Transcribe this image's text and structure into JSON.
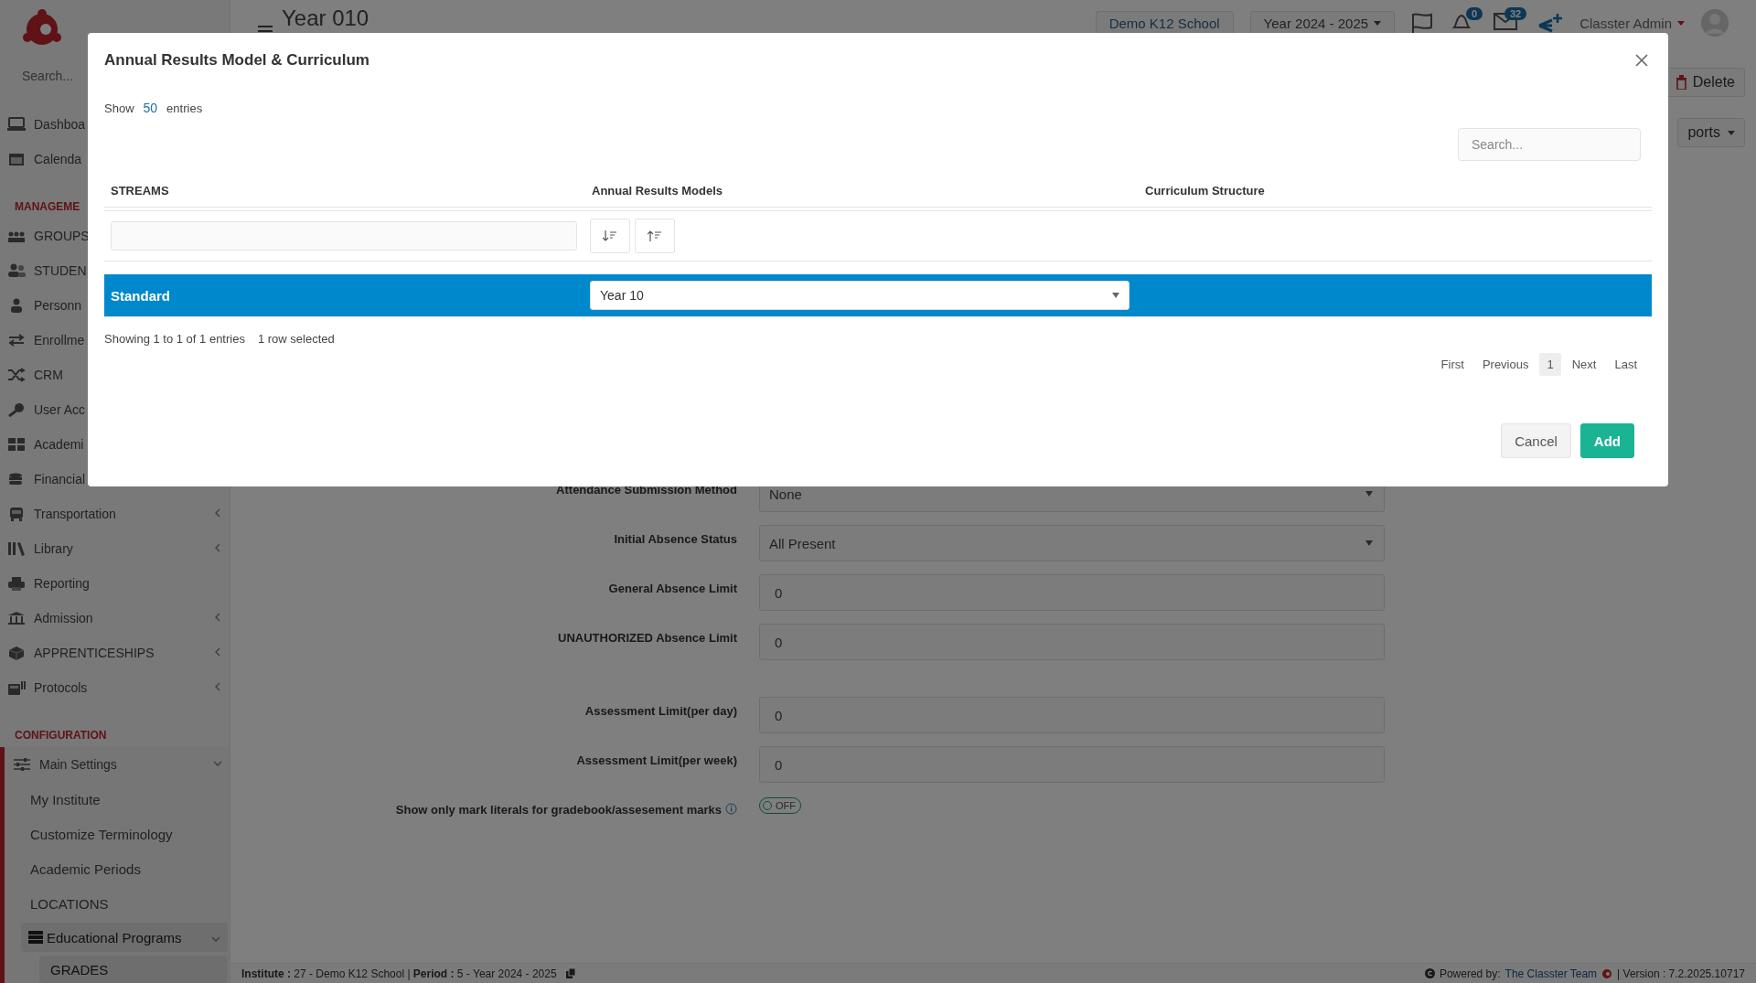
{
  "header": {
    "title": "Year 010",
    "school_button": "Demo K12 School",
    "year_dropdown": "Year 2024 - 2025",
    "notification_count": "0",
    "message_count": "32",
    "user_name": "Classter Admin"
  },
  "sidebar": {
    "search_placeholder": "Search...",
    "items": [
      {
        "kind": "item",
        "label": "Dashboa"
      },
      {
        "kind": "item",
        "label": "Calenda"
      },
      {
        "kind": "section",
        "label": "MANAGEME"
      },
      {
        "kind": "item",
        "label": "GROUPS"
      },
      {
        "kind": "item",
        "label": "STUDEN"
      },
      {
        "kind": "item",
        "label": "Personn"
      },
      {
        "kind": "item",
        "label": "Enrollme"
      },
      {
        "kind": "item",
        "label": "CRM"
      },
      {
        "kind": "item",
        "label": "User Acc"
      },
      {
        "kind": "item",
        "label": "Academi"
      },
      {
        "kind": "item",
        "label": "Financial"
      },
      {
        "kind": "item",
        "label": "Transportation",
        "expanded": false
      },
      {
        "kind": "item",
        "label": "Library",
        "expanded": false
      },
      {
        "kind": "item",
        "label": "Reporting"
      },
      {
        "kind": "item",
        "label": "Admission",
        "expanded": false
      },
      {
        "kind": "item",
        "label": "APPRENTICESHIPS",
        "expanded": false
      },
      {
        "kind": "item",
        "label": "Protocols",
        "expanded": false
      },
      {
        "kind": "section",
        "label": "CONFIGURATION"
      },
      {
        "kind": "item",
        "label": "Main Settings",
        "expanded": true,
        "children": [
          {
            "label": "My Institute"
          },
          {
            "label": "Customize Terminology"
          },
          {
            "label": "Academic Periods"
          },
          {
            "label": "LOCATIONS"
          },
          {
            "label": "Educational Programs",
            "expanded": true,
            "children": [
              {
                "label": "GRADES"
              }
            ]
          }
        ]
      }
    ]
  },
  "actions": {
    "delete_button": "Delete",
    "reports_button": "ports"
  },
  "form": {
    "groups": [
      [
        {
          "label": "Attendance Submission Method",
          "kind": "select",
          "value": "None"
        },
        {
          "label": "Initial Absence Status",
          "kind": "select",
          "value": "All Present"
        },
        {
          "label": "General Absence Limit",
          "kind": "input",
          "value": "0"
        },
        {
          "label": "UNAUTHORIZED Absence Limit",
          "kind": "input",
          "value": "0"
        }
      ],
      [
        {
          "label": "Assessment Limit(per day)",
          "kind": "input",
          "value": "0"
        },
        {
          "label": "Assessment Limit(per week)",
          "kind": "input",
          "value": "0"
        },
        {
          "label": "Show only mark literals for gradebook/assesement marks",
          "kind": "toggle",
          "on": false,
          "value": "OFF"
        }
      ]
    ]
  },
  "modal": {
    "title": "Annual Results Model & Curriculum",
    "length": {
      "prefix": "Show",
      "value": "50",
      "suffix": "entries"
    },
    "search_placeholder": "Search...",
    "columns": [
      "STREAMS",
      "Annual Results Models",
      "Curriculum Structure"
    ],
    "rows": [
      {
        "stream": "Standard",
        "model": "Year 10",
        "selected": true
      }
    ],
    "info": "Showing 1 to 1 of 1 entries",
    "selection_info": "1 row selected",
    "pagination": [
      {
        "label": "First",
        "selected": false
      },
      {
        "label": "Previous",
        "selected": false
      },
      {
        "label": "1",
        "selected": true
      },
      {
        "label": "Next",
        "selected": false
      },
      {
        "label": "Last",
        "selected": false
      }
    ],
    "buttons": [
      {
        "label": "Cancel",
        "kind": "secondary"
      },
      {
        "label": "Add",
        "kind": "primary"
      }
    ]
  },
  "status_bar": {
    "institute": "**Institute :** 27 - Demo K12 School | **Period :** 5 - Year 2024 - 2025",
    "powered_by": "Powered by:",
    "team_link": "The Classter Team",
    "version": "| Version : 7.2.2025.10717"
  }
}
